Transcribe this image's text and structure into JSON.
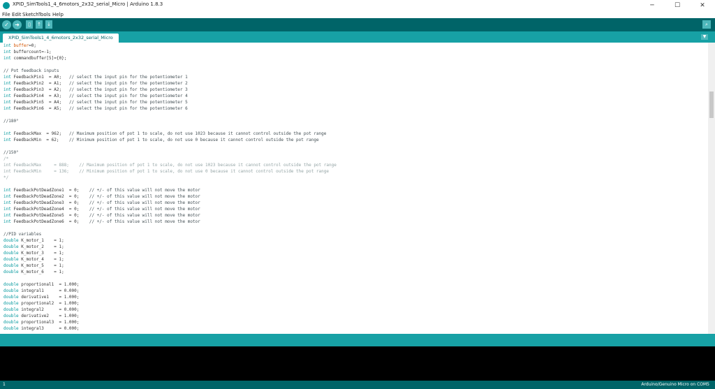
{
  "window": {
    "title": "XPID_SimTools1_4_6motors_2x32_serial_Micro | Arduino 1.8.3",
    "controls": {
      "minimize": "─",
      "maximize": "☐",
      "close": "✕"
    }
  },
  "menu": [
    "File",
    "Edit",
    "Sketch",
    "Tools",
    "Help"
  ],
  "toolbar": {
    "verify_icon": "check-icon",
    "upload_icon": "arrow-right-icon",
    "new_icon": "file-icon",
    "open_icon": "arrow-up-icon",
    "save_icon": "arrow-down-icon",
    "serial_monitor_icon": "magnifier-icon"
  },
  "tab": {
    "label": "XPID_SimTools1_4_6motors_2x32_serial_Micro"
  },
  "code": [
    [
      [
        "kw",
        "int"
      ],
      [
        "n",
        " "
      ],
      [
        "or",
        "buffer"
      ],
      [
        "n",
        "=0;"
      ]
    ],
    [
      [
        "kw",
        "int"
      ],
      [
        "n",
        " buffercount=-1;"
      ]
    ],
    [
      [
        "kw",
        "int"
      ],
      [
        "n",
        " commandbuffer[5]={0};"
      ]
    ],
    [],
    [
      [
        "cm",
        "// Pot feedback inputs"
      ]
    ],
    [
      [
        "kw",
        "int"
      ],
      [
        "n",
        " FeedbackPin1  = A0;   "
      ],
      [
        "cm",
        "// select the input pin for the potentiometer 1"
      ]
    ],
    [
      [
        "kw",
        "int"
      ],
      [
        "n",
        " FeedbackPin2  = A1;   "
      ],
      [
        "cm",
        "// select the input pin for the potentiometer 2"
      ]
    ],
    [
      [
        "kw",
        "int"
      ],
      [
        "n",
        " FeedbackPin3  = A2;   "
      ],
      [
        "cm",
        "// select the input pin for the potentiometer 3"
      ]
    ],
    [
      [
        "kw",
        "int"
      ],
      [
        "n",
        " FeedbackPin4  = A3;   "
      ],
      [
        "cm",
        "// select the input pin for the potentiometer 4"
      ]
    ],
    [
      [
        "kw",
        "int"
      ],
      [
        "n",
        " FeedbackPin5  = A4;   "
      ],
      [
        "cm",
        "// select the input pin for the potentiometer 5"
      ]
    ],
    [
      [
        "kw",
        "int"
      ],
      [
        "n",
        " FeedbackPin6  = A5;   "
      ],
      [
        "cm",
        "// select the input pin for the potentiometer 6"
      ]
    ],
    [],
    [
      [
        "cm",
        "//180°"
      ]
    ],
    [],
    [
      [
        "kw",
        "int"
      ],
      [
        "n",
        " FeedbackMax  = 962;   "
      ],
      [
        "cm",
        "// Maximum position of pot 1 to scale, do not use 1023 because it cannot control outside the pot range"
      ]
    ],
    [
      [
        "kw",
        "int"
      ],
      [
        "n",
        " FeedbackMin  = 62;    "
      ],
      [
        "cm",
        "// Minimum position of pot 1 to scale, do not use 0 because it cannot control outside the pot range"
      ]
    ],
    [],
    [
      [
        "cm",
        "//150°"
      ]
    ],
    [
      [
        "dim",
        "/*"
      ]
    ],
    [
      [
        "dim",
        "int FeedbackMax     = 888;    // Maximum position of pot 1 to scale, do not use 1023 because it cannot control outside the pot range"
      ]
    ],
    [
      [
        "dim",
        "int FeedbackMin     = 136;    // Minimum position of pot 1 to scale, do not use 0 because it cannot control outside the pot range"
      ]
    ],
    [
      [
        "dim",
        "*/"
      ]
    ],
    [],
    [
      [
        "kw",
        "int"
      ],
      [
        "n",
        " FeedbackPotDeadZone1  = 0;    "
      ],
      [
        "cm",
        "// +/- of this value will not move the motor"
      ]
    ],
    [
      [
        "kw",
        "int"
      ],
      [
        "n",
        " FeedbackPotDeadZone2  = 0;    "
      ],
      [
        "cm",
        "// +/- of this value will not move the motor"
      ]
    ],
    [
      [
        "kw",
        "int"
      ],
      [
        "n",
        " FeedbackPotDeadZone3  = 0;    "
      ],
      [
        "cm",
        "// +/- of this value will not move the motor"
      ]
    ],
    [
      [
        "kw",
        "int"
      ],
      [
        "n",
        " FeedbackPotDeadZone4  = 0;    "
      ],
      [
        "cm",
        "// +/- of this value will not move the motor"
      ]
    ],
    [
      [
        "kw",
        "int"
      ],
      [
        "n",
        " FeedbackPotDeadZone5  = 0;    "
      ],
      [
        "cm",
        "// +/- of this value will not move the motor"
      ]
    ],
    [
      [
        "kw",
        "int"
      ],
      [
        "n",
        " FeedbackPotDeadZone6  = 0;    "
      ],
      [
        "cm",
        "// +/- of this value will not move the motor"
      ]
    ],
    [],
    [
      [
        "cm",
        "//PID variables"
      ]
    ],
    [
      [
        "kw",
        "double"
      ],
      [
        "n",
        " K_motor_1    = 1;"
      ]
    ],
    [
      [
        "kw",
        "double"
      ],
      [
        "n",
        " K_motor_2    = 1;"
      ]
    ],
    [
      [
        "kw",
        "double"
      ],
      [
        "n",
        " K_motor_3    = 1;"
      ]
    ],
    [
      [
        "kw",
        "double"
      ],
      [
        "n",
        " K_motor_4    = 1;"
      ]
    ],
    [
      [
        "kw",
        "double"
      ],
      [
        "n",
        " K_motor_5    = 1;"
      ]
    ],
    [
      [
        "kw",
        "double"
      ],
      [
        "n",
        " K_motor_6    = 1;"
      ]
    ],
    [],
    [
      [
        "kw",
        "double"
      ],
      [
        "n",
        " proportional1  = 1.000;"
      ]
    ],
    [
      [
        "kw",
        "double"
      ],
      [
        "n",
        " integral1      = 0.000;"
      ]
    ],
    [
      [
        "kw",
        "double"
      ],
      [
        "n",
        " derivative1    = 1.000;"
      ]
    ],
    [
      [
        "kw",
        "double"
      ],
      [
        "n",
        " proportional2  = 1.000;"
      ]
    ],
    [
      [
        "kw",
        "double"
      ],
      [
        "n",
        " integral2      = 0.000;"
      ]
    ],
    [
      [
        "kw",
        "double"
      ],
      [
        "n",
        " derivative2    = 1.000;"
      ]
    ],
    [
      [
        "kw",
        "double"
      ],
      [
        "n",
        " proportional3  = 1.000;"
      ]
    ],
    [
      [
        "kw",
        "double"
      ],
      [
        "n",
        " integral3      = 0.000;"
      ]
    ]
  ],
  "status": {
    "line": "1",
    "board": "Arduino/Genuino Micro on COM5"
  },
  "colors": {
    "toolbar": "#006468",
    "tabbar": "#17a1a5",
    "keyword": "#00979c",
    "variable": "#d35400",
    "console": "#000000"
  }
}
